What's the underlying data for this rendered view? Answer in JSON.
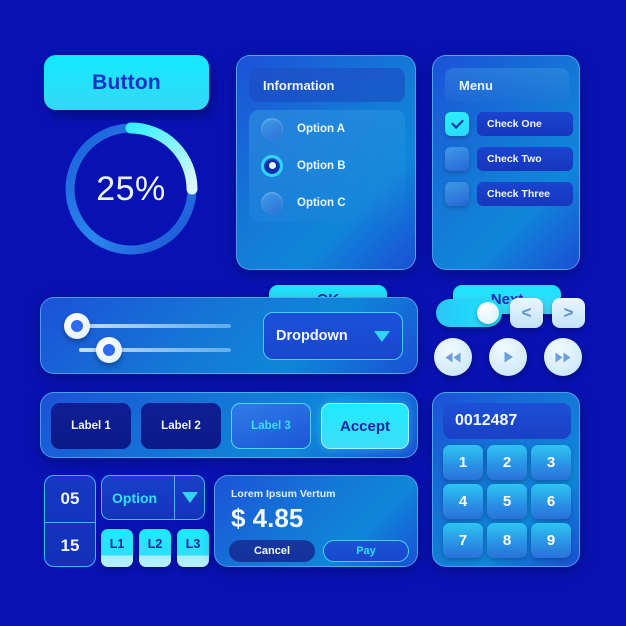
{
  "theme": {
    "background": "#0812b2",
    "accent_cyan": "#22e3fb",
    "panel_blue": "#1478d6",
    "text_light": "#f0f7ff",
    "text_dark": "#15259f"
  },
  "main_button": {
    "label": "Button"
  },
  "progress": {
    "value": 25,
    "label": "25%",
    "track_color": "#1f6fe0",
    "arc_color": "#2fe6ff"
  },
  "information_card": {
    "title": "Information",
    "options": [
      {
        "label": "Option A",
        "selected": false
      },
      {
        "label": "Option B",
        "selected": true
      },
      {
        "label": "Option C",
        "selected": false
      }
    ],
    "confirm_label": "OK"
  },
  "menu_card": {
    "title": "Menu",
    "checks": [
      {
        "label": "Check One",
        "checked": true
      },
      {
        "label": "Check Two",
        "checked": false
      },
      {
        "label": "Check Three",
        "checked": false
      }
    ],
    "next_label": "Next"
  },
  "slider_panel": {
    "sliders": [
      {
        "value": 8
      },
      {
        "value": 18
      }
    ],
    "dropdown": {
      "value": "Dropdown",
      "arrow_icon": "chevron-down-icon"
    }
  },
  "controls": {
    "toggle": {
      "state": "on"
    },
    "prev_label": "<",
    "next_label": ">",
    "media": [
      {
        "name": "rewind-icon"
      },
      {
        "name": "play-icon"
      },
      {
        "name": "fast-forward-icon"
      }
    ]
  },
  "labels_panel": {
    "chips": [
      {
        "label": "Label 1",
        "style": "dark"
      },
      {
        "label": "Label 2",
        "style": "dark"
      },
      {
        "label": "Label 3",
        "style": "blue"
      },
      {
        "label": "Accept",
        "style": "cyan"
      }
    ]
  },
  "stepper": {
    "top_value": "05",
    "bottom_value": "15"
  },
  "option_select": {
    "value": "Option",
    "arrow_icon": "chevron-down-icon"
  },
  "l_buttons": [
    {
      "label": "L1"
    },
    {
      "label": "L2"
    },
    {
      "label": "L3"
    }
  ],
  "payment_card": {
    "title": "Lorem Ipsum Vertum",
    "amount": "$ 4.85",
    "cancel_label": "Cancel",
    "pay_label": "Pay"
  },
  "keypad": {
    "display_value": "0012487",
    "keys": [
      "1",
      "2",
      "3",
      "4",
      "5",
      "6",
      "7",
      "8",
      "9"
    ]
  }
}
